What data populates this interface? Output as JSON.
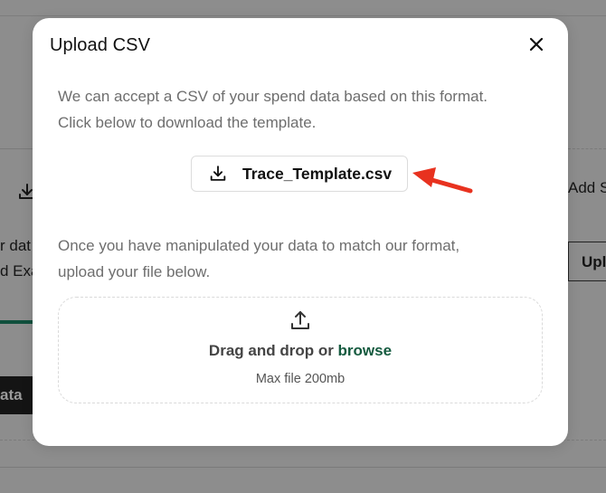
{
  "background": {
    "left_line_1": "r dat",
    "left_line_2": "d Exa",
    "left_button": "ata",
    "right_link": "Add S",
    "right_button": "Upl"
  },
  "modal": {
    "title": "Upload CSV",
    "description_line_1": "We can accept a CSV of your spend data based on this format.",
    "description_line_2": "Click below to download the template.",
    "download_button_label": "Trace_Template.csv",
    "instruction_line_1": "Once you have manipulated your data to match our format,",
    "instruction_line_2": "upload your file below.",
    "dropzone": {
      "prefix": "Drag and drop or ",
      "browse_label": "browse",
      "max_size": "Max file 200mb"
    }
  },
  "colors": {
    "accent_green": "#145a3f",
    "arrow_red": "#e8321f",
    "overlay": "#8d8d8d"
  },
  "icons": {
    "close": "close-icon",
    "download": "download-icon",
    "upload": "upload-icon",
    "annotation": "red-arrow-icon"
  }
}
